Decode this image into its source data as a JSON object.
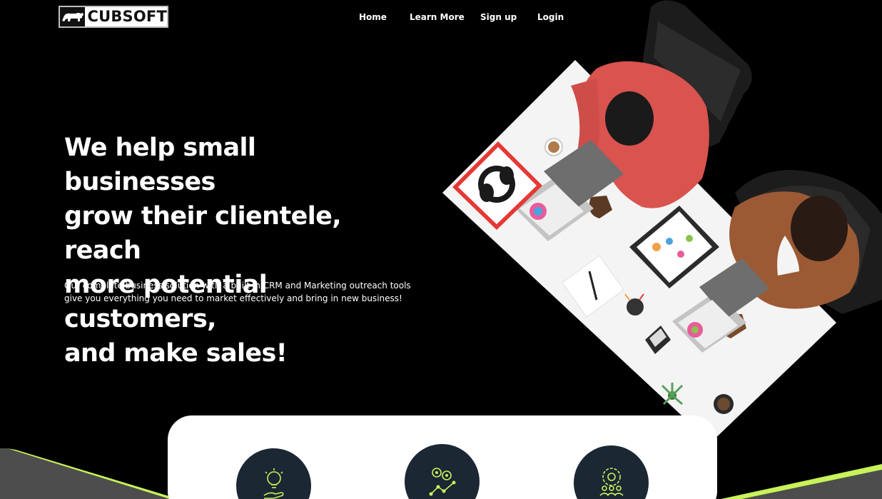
{
  "brand": {
    "name": "CUBSOFT",
    "logo_icon": "bear-icon"
  },
  "nav": {
    "items": [
      {
        "label": "Home"
      },
      {
        "label": "Learn More"
      },
      {
        "label": "Sign up"
      },
      {
        "label": "Login"
      }
    ]
  },
  "hero": {
    "headline_lines": [
      "We help small businesses",
      "grow their clientele, reach",
      "more potential customers,",
      "and make sales!"
    ],
    "subtext_lines": [
      "Our complete business solution with a built in CRM and Marketing outreach tools",
      "give you everything you need to market effectively and bring in new business!"
    ],
    "image": "two-people-working-at-desk-from-above"
  },
  "features": {
    "icons": [
      "lightbulb-hand-icon",
      "gears-growth-icon",
      "team-gear-icon"
    ]
  },
  "colors": {
    "background": "#000000",
    "card": "#ffffff",
    "icon_circle": "#1b2733",
    "accent": "#c8f25a",
    "gray_shape": "#4d4d4d"
  }
}
